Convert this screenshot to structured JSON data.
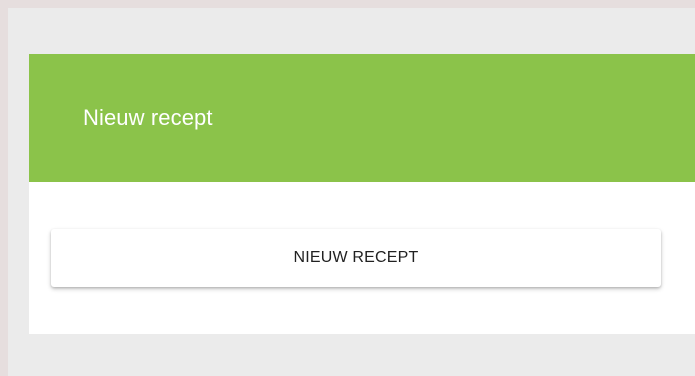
{
  "card": {
    "title": "Nieuw recept",
    "button_label": "NIEUW RECEPT"
  },
  "colors": {
    "header": "#8bc34a",
    "page_background": "#ebebeb",
    "outer_background": "#e6dede",
    "card_background": "#ffffff"
  }
}
